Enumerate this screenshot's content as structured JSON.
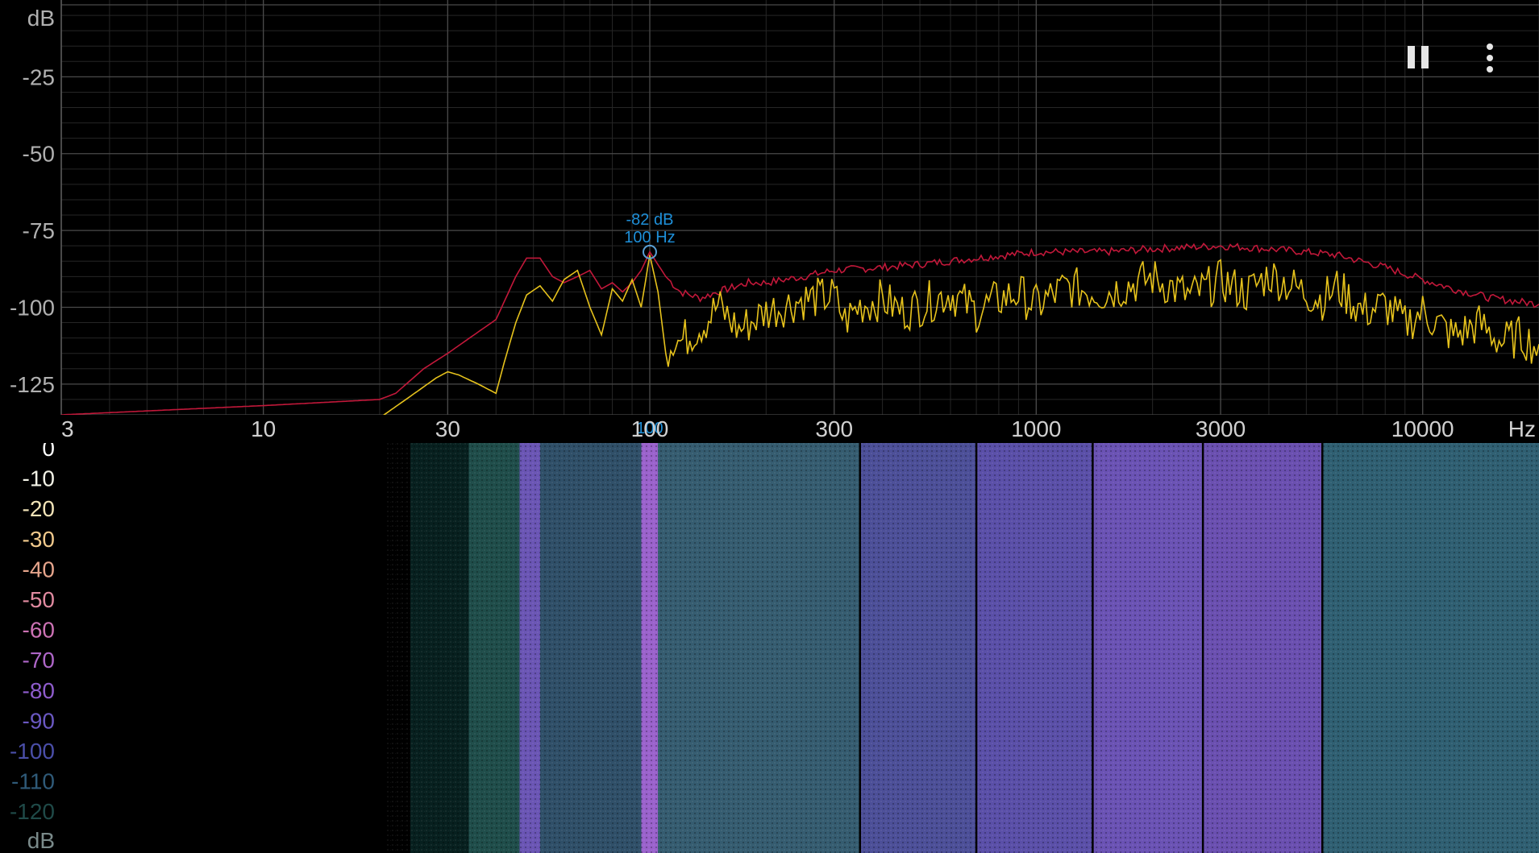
{
  "chart_data": [
    {
      "type": "line",
      "y_unit": "dB",
      "x_unit": "Hz",
      "x_scale": "log",
      "xlim": [
        3,
        20000
      ],
      "ylim": [
        -135,
        0
      ],
      "grid": true,
      "y_ticks": [
        "-25",
        "-50",
        "-75",
        "-100",
        "-125"
      ],
      "x_ticks": [
        {
          "value": 3,
          "label": "3"
        },
        {
          "value": 10,
          "label": "10"
        },
        {
          "value": 30,
          "label": "30"
        },
        {
          "value": 100,
          "label": "100"
        },
        {
          "value": 300,
          "label": "300"
        },
        {
          "value": 1000,
          "label": "1000"
        },
        {
          "value": 3000,
          "label": "3000"
        },
        {
          "value": 10000,
          "label": "10000"
        }
      ],
      "cursor": {
        "freq": 100,
        "db": -82,
        "label_db": "-82 dB",
        "label_hz": "100 Hz",
        "axis_label": "100"
      },
      "series": [
        {
          "color": "#c2183a",
          "x": [
            3,
            10,
            20,
            22,
            26,
            30,
            36,
            40,
            45,
            48,
            52,
            56,
            60,
            65,
            70,
            75,
            80,
            85,
            90,
            95,
            100,
            110,
            120,
            135,
            150,
            180,
            200,
            250,
            300,
            400,
            500,
            700,
            1000,
            1500,
            2000,
            3000,
            4000,
            5000,
            6000,
            8000,
            10000,
            12000,
            15000,
            20000
          ],
          "y": [
            -135,
            -132,
            -130,
            -128,
            -120,
            -115,
            -108,
            -104,
            -90,
            -84,
            -84,
            -90,
            -92,
            -90,
            -88,
            -94,
            -92,
            -95,
            -92,
            -88,
            -82,
            -90,
            -95,
            -97,
            -95,
            -92,
            -92,
            -90,
            -88,
            -87,
            -86,
            -84,
            -82,
            -82,
            -81,
            -80,
            -81,
            -82,
            -83,
            -87,
            -91,
            -94,
            -97,
            -99
          ]
        },
        {
          "color": "#e6c21c",
          "x": [
            3,
            10,
            20,
            24,
            28,
            30,
            32,
            36,
            40,
            42,
            45,
            48,
            52,
            56,
            60,
            65,
            70,
            75,
            80,
            85,
            90,
            95,
            100,
            105,
            110,
            115,
            120,
            140,
            150,
            170,
            200,
            250,
            300,
            320,
            350,
            400,
            450,
            500,
            600,
            700,
            800,
            900,
            1000,
            1200,
            1500,
            2000,
            2500,
            3000,
            3500,
            4000,
            5000,
            5500,
            6000,
            7000,
            8000,
            9000,
            10000,
            12000,
            14000,
            16000,
            18000,
            20000
          ],
          "y": [
            -136,
            -136,
            -136,
            -129,
            -123,
            -121,
            -122,
            -125,
            -128,
            -118,
            -105,
            -96,
            -93,
            -98,
            -91,
            -88,
            -100,
            -109,
            -94,
            -98,
            -91,
            -100,
            -83,
            -95,
            -115,
            -108,
            -110,
            -103,
            -98,
            -106,
            -100,
            -96,
            -95,
            -103,
            -98,
            -96,
            -100,
            -98,
            -94,
            -100,
            -96,
            -94,
            -98,
            -92,
            -94,
            -89,
            -95,
            -90,
            -94,
            -88,
            -94,
            -96,
            -92,
            -100,
            -98,
            -104,
            -100,
            -108,
            -104,
            -110,
            -108,
            -112
          ]
        }
      ]
    },
    {
      "type": "heatmap",
      "y_unit": "dB",
      "scale_labels": [
        "0",
        "-10",
        "-20",
        "-30",
        "-40",
        "-50",
        "-60",
        "-70",
        "-80",
        "-90",
        "-100",
        "-110",
        "-120"
      ],
      "scale_colors": [
        "#ffffff",
        "#f2f2e6",
        "#f2e4b8",
        "#f0c98c",
        "#e6a58c",
        "#e08aa0",
        "#cc72b4",
        "#ae66c8",
        "#8e5ccc",
        "#6a58c2",
        "#4a4ea8",
        "#2f5a78",
        "#1f4a48"
      ],
      "freq_bands": [
        {
          "from": 3,
          "to": 24,
          "color": "#000000"
        },
        {
          "from": 24,
          "to": 34,
          "color": "#07201f"
        },
        {
          "from": 34,
          "to": 46,
          "color": "#1f4d4a"
        },
        {
          "from": 46,
          "to": 52,
          "color": "#6a55b4"
        },
        {
          "from": 52,
          "to": 95,
          "color": "#2f4f68"
        },
        {
          "from": 95,
          "to": 105,
          "color": "#9a62cc"
        },
        {
          "from": 105,
          "to": 350,
          "color": "#355c70"
        },
        {
          "from": 350,
          "to": 700,
          "color": "#4c4f98"
        },
        {
          "from": 700,
          "to": 1400,
          "color": "#5a4fa8"
        },
        {
          "from": 1400,
          "to": 2700,
          "color": "#6a52b4"
        },
        {
          "from": 2700,
          "to": 5500,
          "color": "#6a4fb0"
        },
        {
          "from": 5500,
          "to": 20000,
          "color": "#2f5f72"
        }
      ],
      "divider_freqs": [
        350,
        700,
        1400,
        2700,
        5500
      ]
    }
  ],
  "icons": {
    "pause": "pause-icon",
    "menu": "more-vert-icon"
  }
}
